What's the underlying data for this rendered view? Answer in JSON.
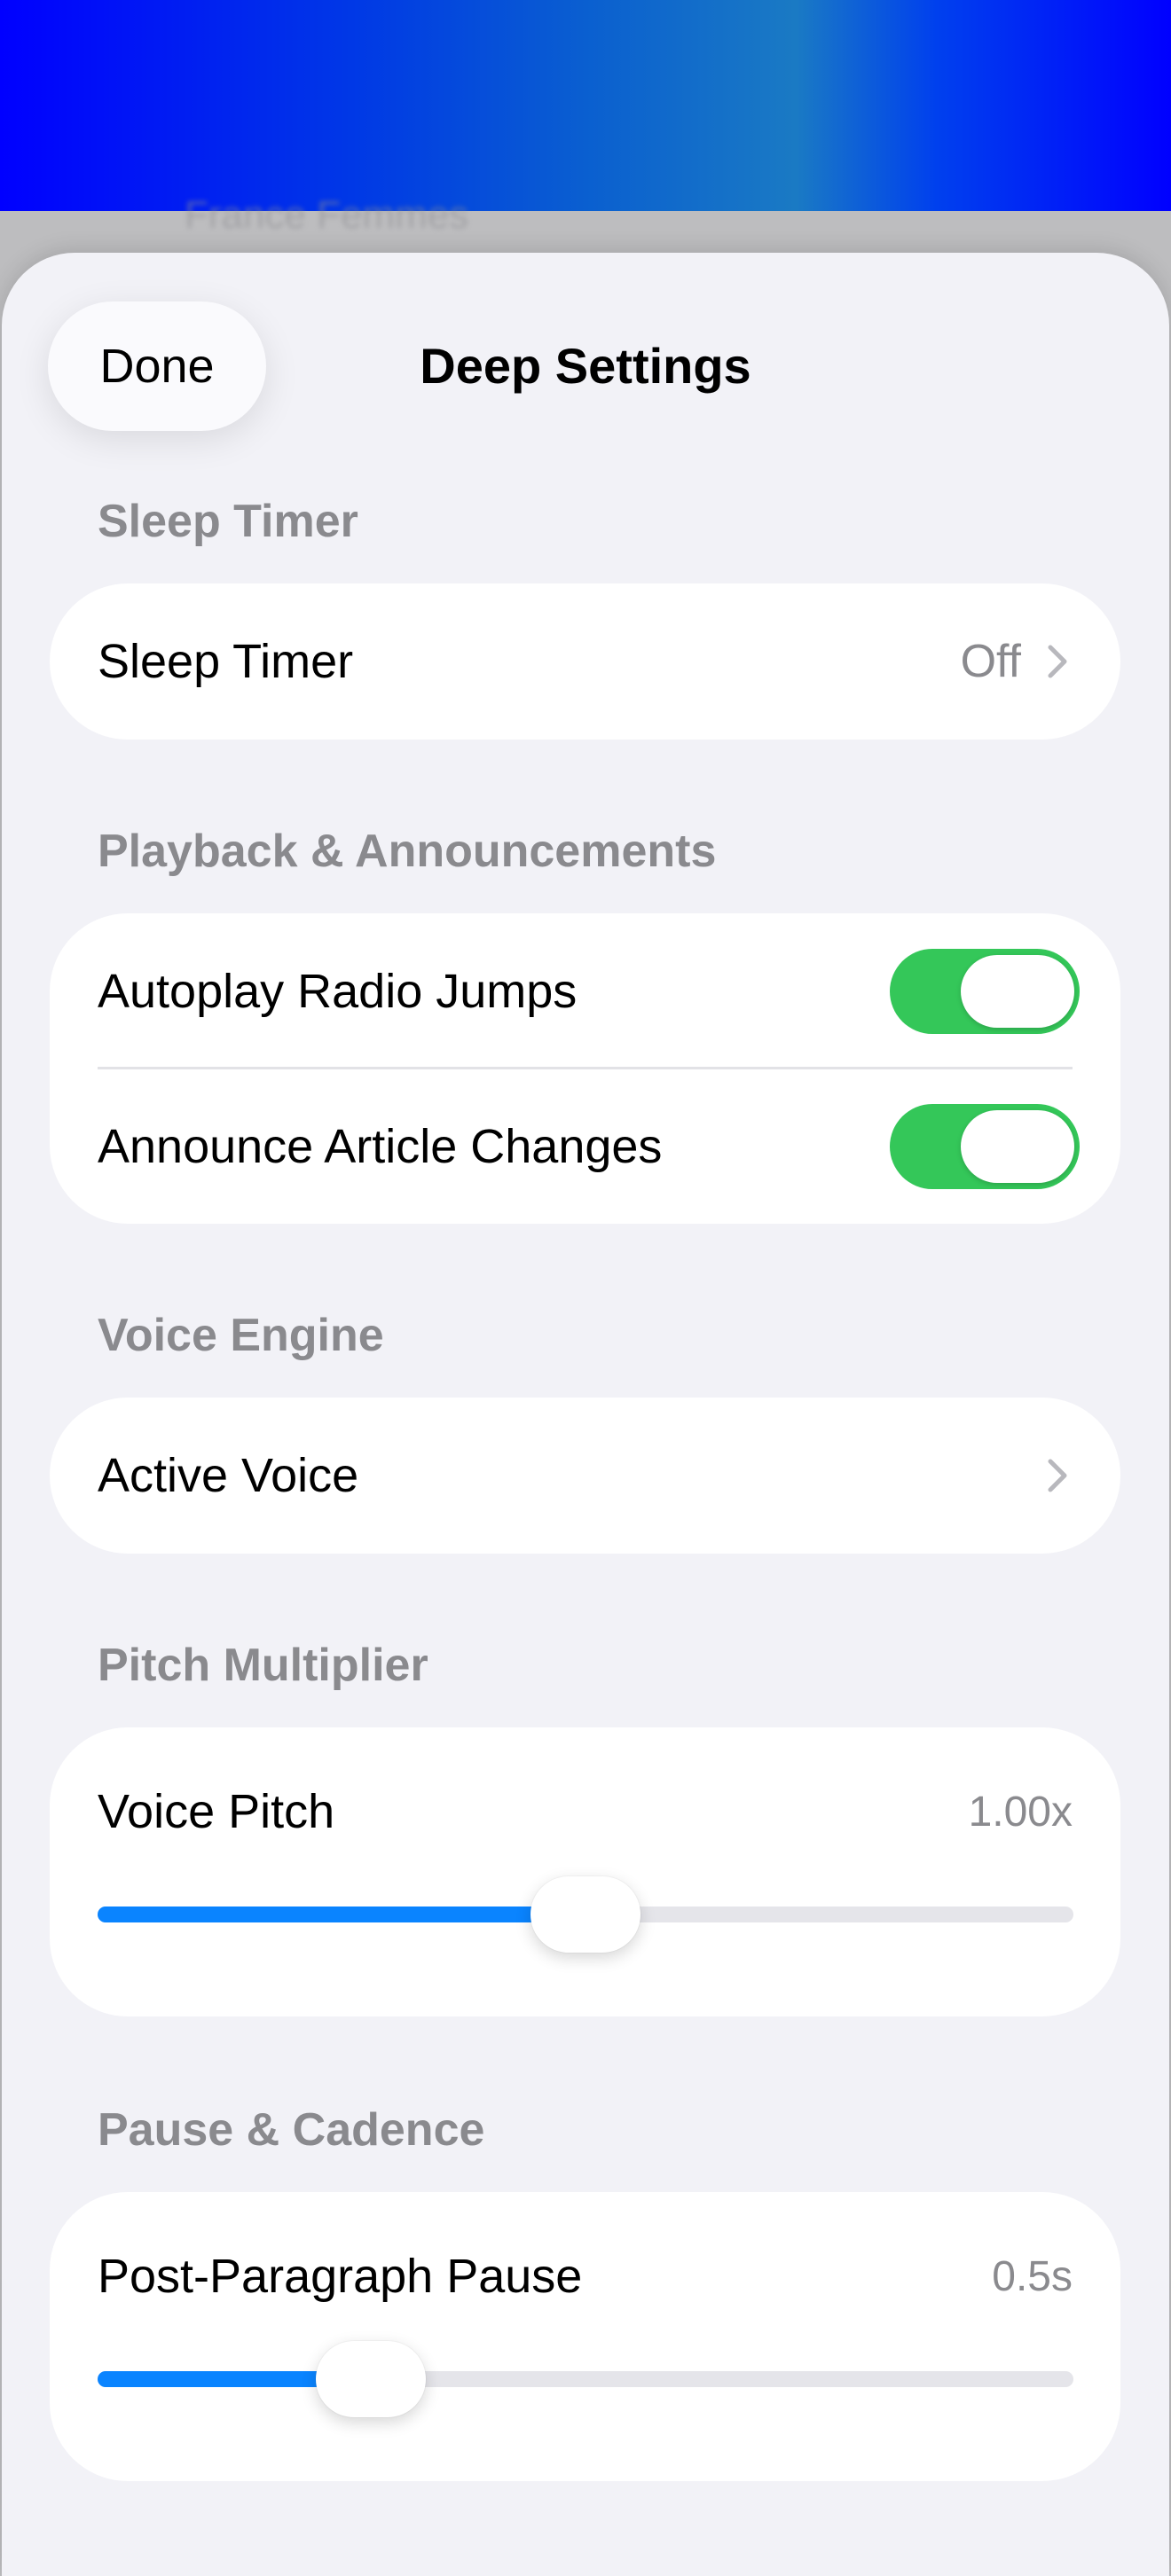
{
  "background": {
    "partial_text": "France Femmes"
  },
  "header": {
    "done_label": "Done",
    "title": "Deep Settings"
  },
  "sleep_timer": {
    "section_title": "Sleep Timer",
    "row_label": "Sleep Timer",
    "row_value": "Off",
    "chevron_icon": "chevron-right-icon"
  },
  "playback": {
    "section_title": "Playback & Announcements",
    "autoplay_label": "Autoplay Radio Jumps",
    "autoplay_on": true,
    "announce_label": "Announce Article Changes",
    "announce_on": true,
    "toggle_on_color": "#34c759"
  },
  "voice_engine": {
    "section_title": "Voice Engine",
    "row_label": "Active Voice",
    "chevron_icon": "chevron-right-icon"
  },
  "pitch": {
    "section_title": "Pitch Multiplier",
    "row_label": "Voice Pitch",
    "value_text": "1.00x",
    "fraction": 0.5
  },
  "pause": {
    "section_title": "Pause & Cadence",
    "row_label": "Post-Paragraph Pause",
    "value_text": "0.5s",
    "fraction": 0.28
  },
  "colors": {
    "accent": "#0a84ff",
    "toggle_on": "#34c759",
    "sheet_background": "#f2f2f7",
    "secondary_text": "#8a8a8e"
  }
}
